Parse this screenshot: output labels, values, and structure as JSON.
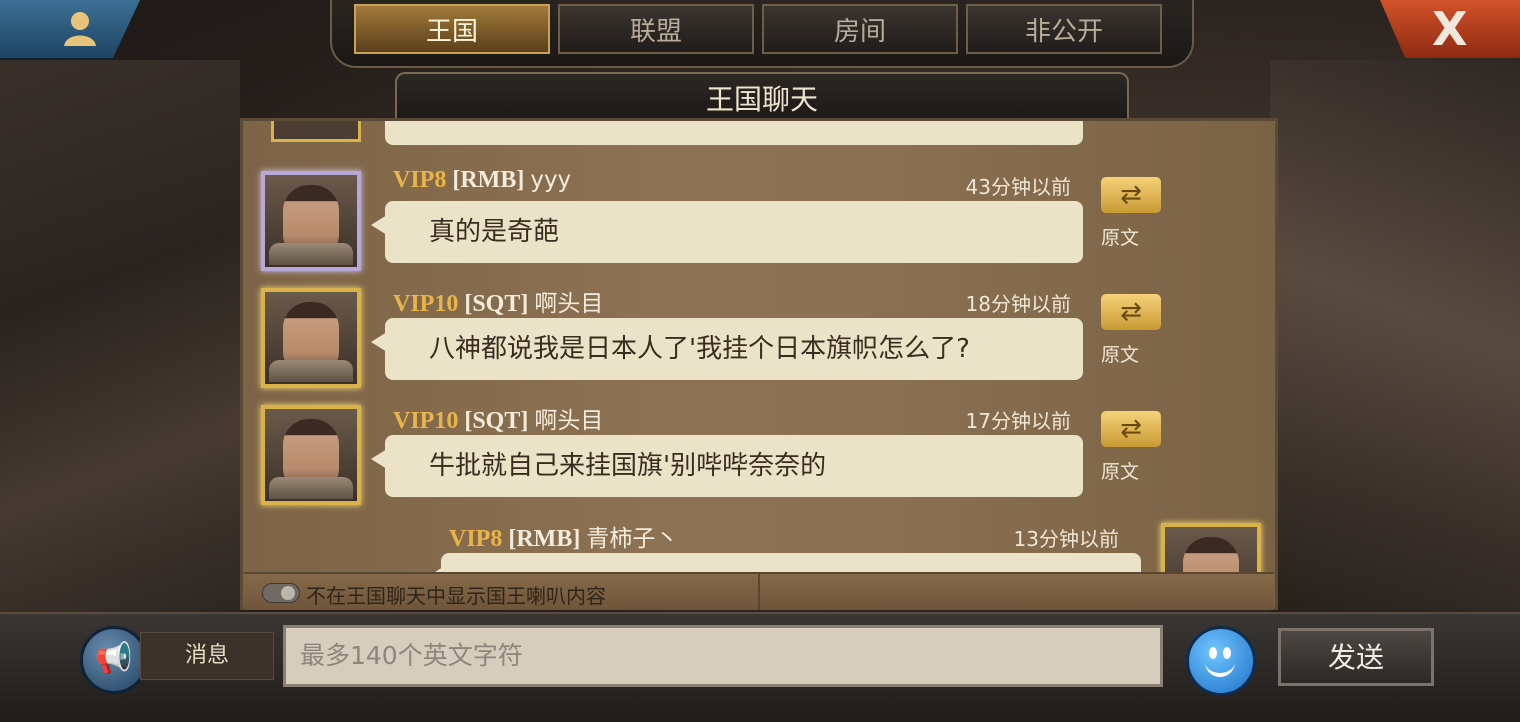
{
  "tabs": [
    {
      "label": "王国",
      "active": true
    },
    {
      "label": "联盟",
      "active": false
    },
    {
      "label": "房间",
      "active": false
    },
    {
      "label": "非公开",
      "active": false
    }
  ],
  "close_label": "X",
  "panel_title": "王国聊天",
  "messages": [
    {
      "vip": "VIP8",
      "tag": "[RMB]",
      "user": "yyy",
      "time": "43分钟以前",
      "text": "真的是奇葩",
      "translate_label": "原文",
      "frame": "purple"
    },
    {
      "vip": "VIP10",
      "tag": "[SQT]",
      "user": "啊头目",
      "time": "18分钟以前",
      "text": "八神都说我是日本人了'我挂个日本旗帜怎么了?",
      "translate_label": "原文",
      "frame": "gold"
    },
    {
      "vip": "VIP10",
      "tag": "[SQT]",
      "user": "啊头目",
      "time": "17分钟以前",
      "text": "牛批就自己来挂国旗'别哔哔奈奈的",
      "translate_label": "原文",
      "frame": "gold"
    }
  ],
  "self_message": {
    "vip": "VIP8",
    "tag": "[RMB]",
    "user": "青柿子丶",
    "time": "13分钟以前"
  },
  "toggle_label": "不在王国聊天中显示国王喇叭内容",
  "input": {
    "channel_label": "消息",
    "placeholder": "最多140个英文字符",
    "send_label": "发送"
  }
}
